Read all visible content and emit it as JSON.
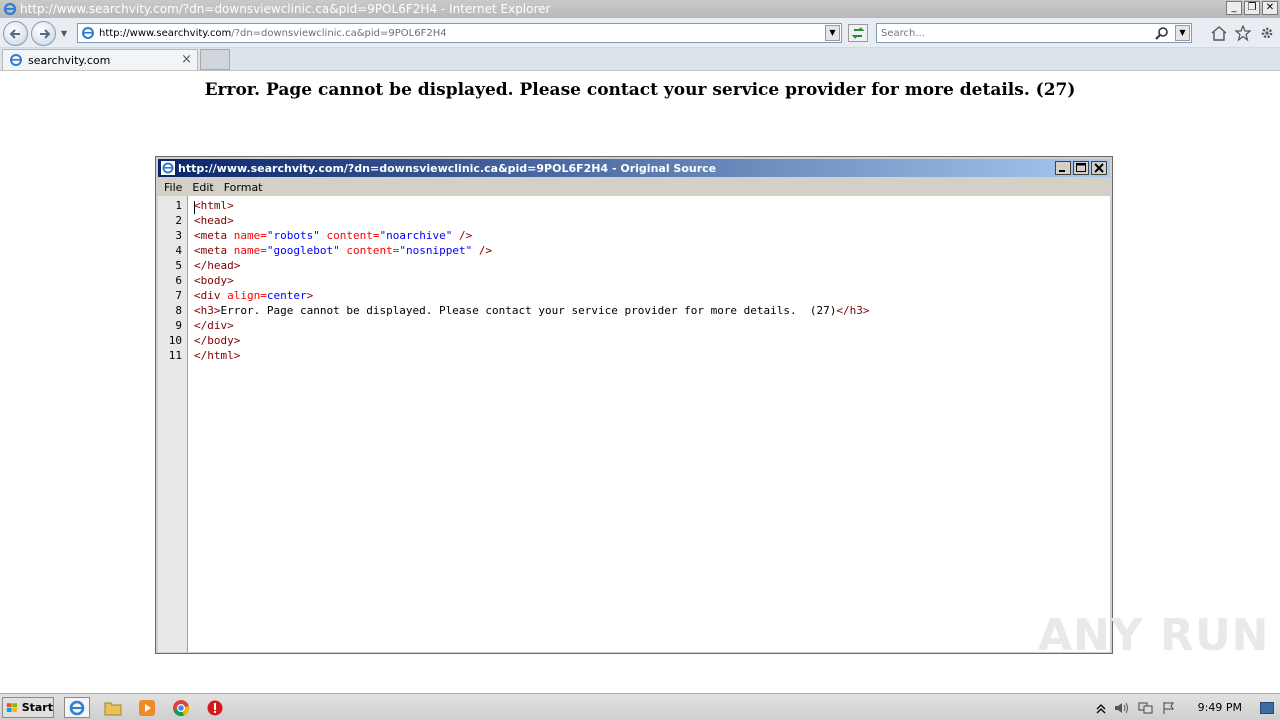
{
  "window": {
    "title": "http://www.searchvity.com/?dn=downsviewclinic.ca&pid=9POL6F2H4 - Internet Explorer",
    "controls": [
      "_",
      "❐",
      "✕"
    ]
  },
  "navbar": {
    "url_host": "http://www.searchvity.com",
    "url_rest": "/?dn=downsviewclinic.ca&pid=9POL6F2H4",
    "search_placeholder": "Search..."
  },
  "tabs": [
    {
      "label": "searchvity.com",
      "close": "×"
    }
  ],
  "page": {
    "error_heading": "Error. Page cannot be displayed. Please contact your service provider for more details. (27)"
  },
  "source_window": {
    "title": "http://www.searchvity.com/?dn=downsviewclinic.ca&pid=9POL6F2H4 - Original Source",
    "menu": [
      "File",
      "Edit",
      "Format"
    ],
    "line_numbers": [
      "1",
      "2",
      "3",
      "4",
      "5",
      "6",
      "7",
      "8",
      "9",
      "10",
      "11"
    ],
    "lines": [
      [
        {
          "t": "tag",
          "s": "<html>"
        }
      ],
      [
        {
          "t": "tag",
          "s": "<head>"
        }
      ],
      [
        {
          "t": "tag",
          "s": "<meta "
        },
        {
          "t": "attr",
          "s": "name="
        },
        {
          "t": "val",
          "s": "\"robots\""
        },
        {
          "t": "attr",
          "s": " content="
        },
        {
          "t": "val",
          "s": "\"noarchive\""
        },
        {
          "t": "tag",
          "s": " />"
        }
      ],
      [
        {
          "t": "tag",
          "s": "<meta "
        },
        {
          "t": "attr",
          "s": "name="
        },
        {
          "t": "val",
          "s": "\"googlebot\""
        },
        {
          "t": "attr",
          "s": " content="
        },
        {
          "t": "val",
          "s": "\"nosnippet\""
        },
        {
          "t": "tag",
          "s": " />"
        }
      ],
      [
        {
          "t": "tag",
          "s": "</head>"
        }
      ],
      [
        {
          "t": "tag",
          "s": "<body>"
        }
      ],
      [
        {
          "t": "tag",
          "s": "<div "
        },
        {
          "t": "attr",
          "s": "align="
        },
        {
          "t": "val",
          "s": "center"
        },
        {
          "t": "tag",
          "s": ">"
        }
      ],
      [
        {
          "t": "tag",
          "s": "<h3>"
        },
        {
          "t": "text",
          "s": "Error. Page cannot be displayed. Please contact your service provider for more details.  (27)"
        },
        {
          "t": "tag",
          "s": "</h3>"
        }
      ],
      [
        {
          "t": "tag",
          "s": "</div>"
        }
      ],
      [
        {
          "t": "tag",
          "s": "</body>"
        }
      ],
      [
        {
          "t": "tag",
          "s": "</html>"
        }
      ]
    ]
  },
  "watermark": "ANY RUN",
  "taskbar": {
    "start_label": "Start",
    "clock": "9:49 PM"
  }
}
